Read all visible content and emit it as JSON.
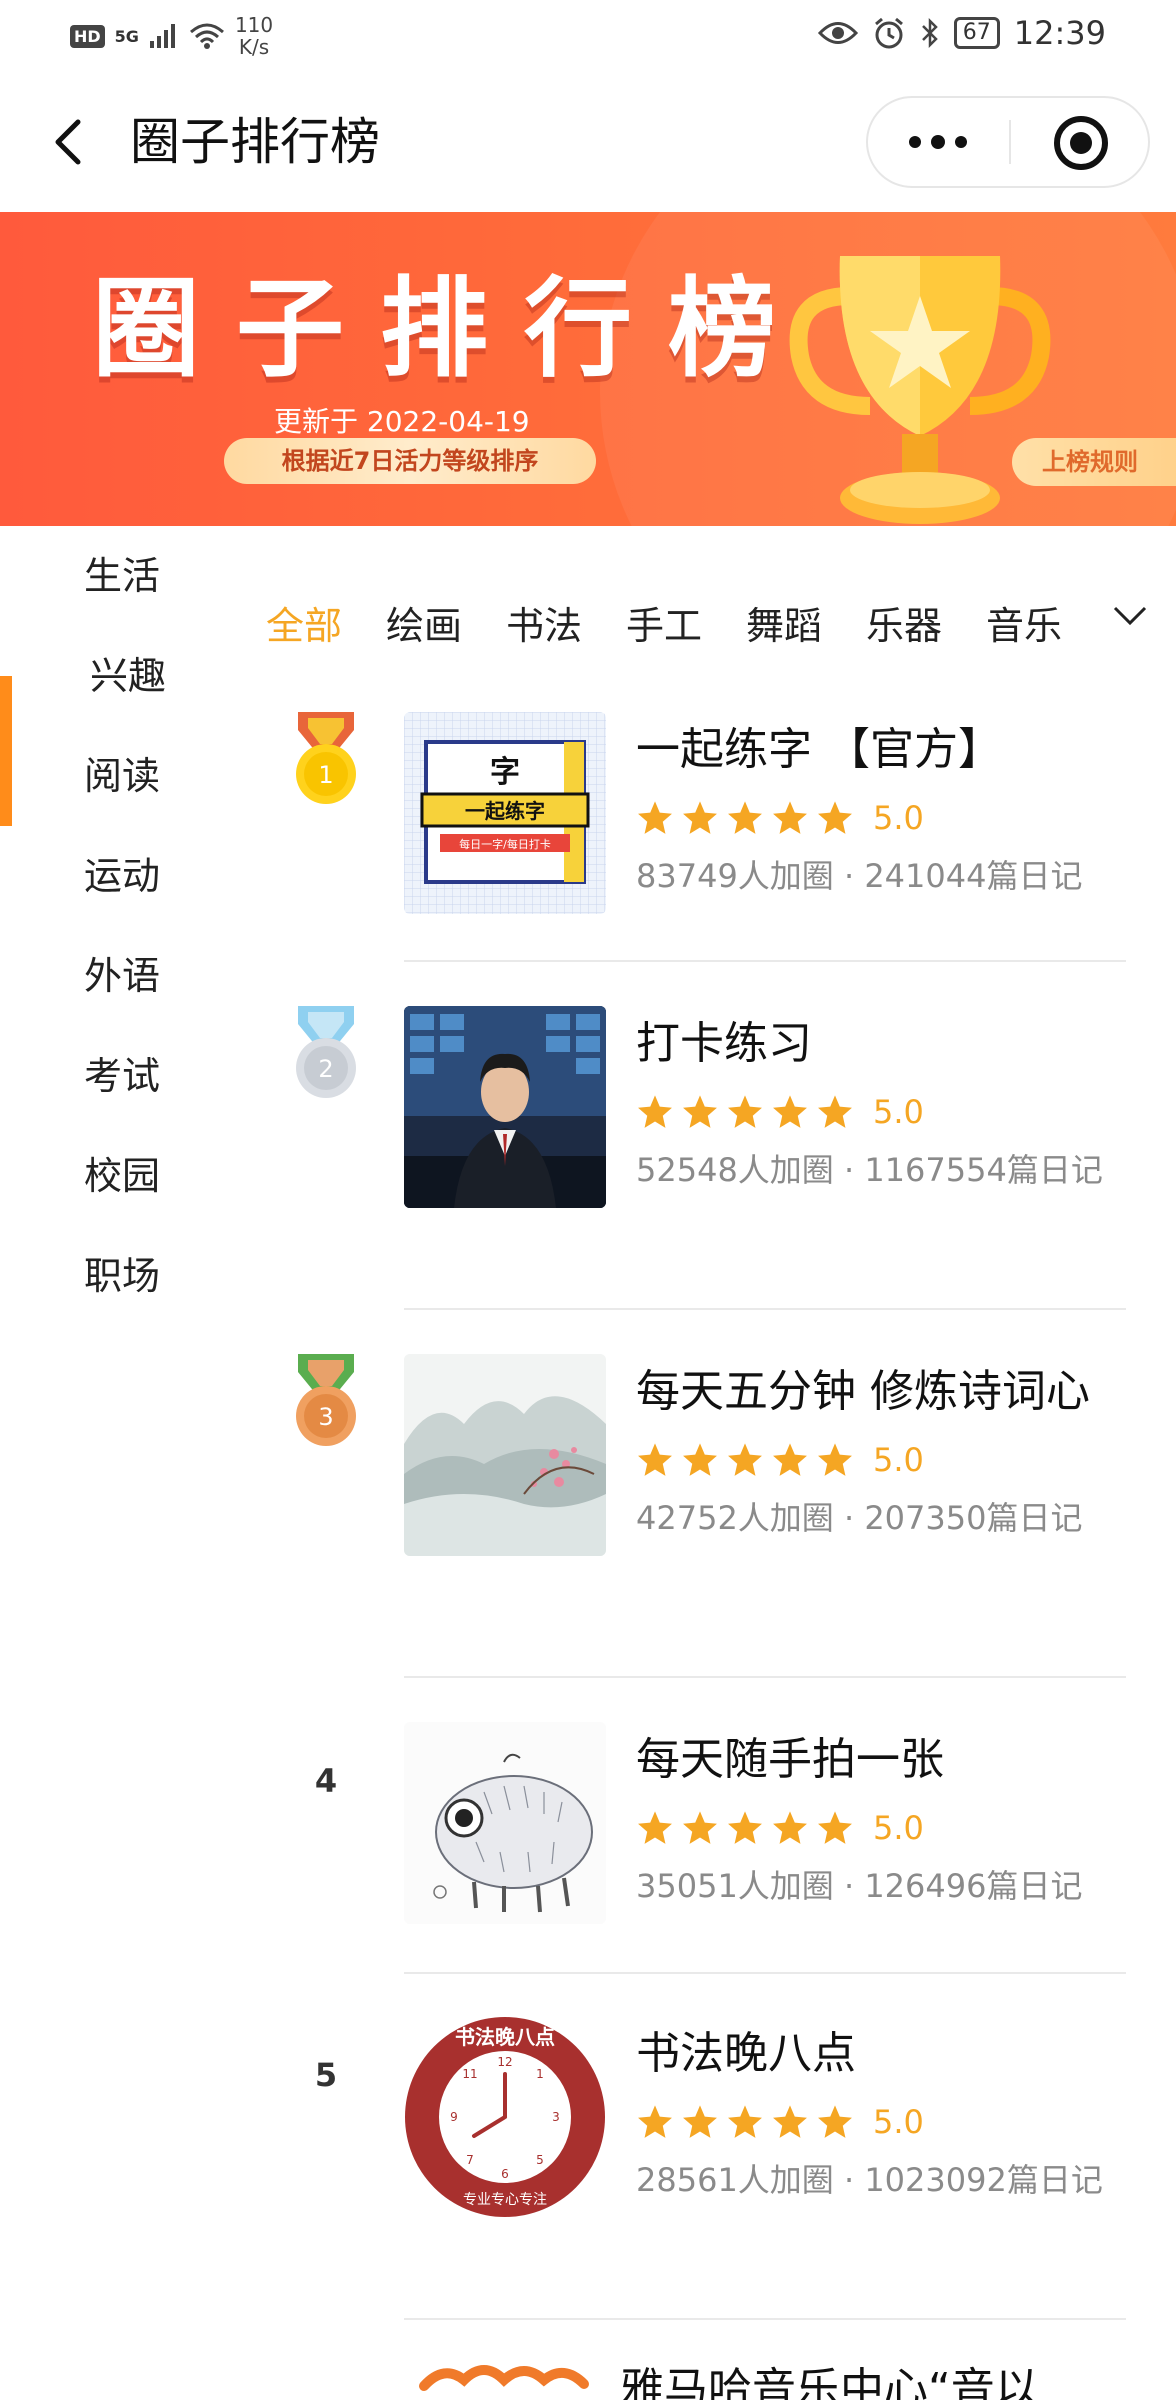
{
  "status_bar": {
    "hd": "HD",
    "network": "5G",
    "speed_value": "110",
    "speed_unit": "K/s",
    "battery": "67",
    "time": "12:39"
  },
  "nav": {
    "title": "圈子排行榜"
  },
  "banner": {
    "title": "圈子排行榜",
    "updated": "更新于 2022-04-19",
    "note": "根据近7日活力等级排序",
    "rule_button": "上榜规则"
  },
  "sidebar": {
    "items": [
      {
        "label": "生活"
      },
      {
        "label": "兴趣"
      },
      {
        "label": "阅读"
      },
      {
        "label": "运动"
      },
      {
        "label": "外语"
      },
      {
        "label": "考试"
      },
      {
        "label": "校园"
      },
      {
        "label": "职场"
      }
    ],
    "active_index": 1
  },
  "tabs": {
    "items": [
      {
        "label": "全部"
      },
      {
        "label": "绘画"
      },
      {
        "label": "书法"
      },
      {
        "label": "手工"
      },
      {
        "label": "舞蹈"
      },
      {
        "label": "乐器"
      },
      {
        "label": "音乐"
      }
    ],
    "active_index": 0
  },
  "list": [
    {
      "rank": "1",
      "medal": "gold",
      "name": "一起练字 【官方】",
      "rating": "5.0",
      "stars": 5,
      "meta": "83749人加圈 · 241044篇日记",
      "thumb": {
        "line1": "字",
        "line2": "一起练字",
        "line3": "每日一字/每日打卡"
      }
    },
    {
      "rank": "2",
      "medal": "silver",
      "name": "打卡练习",
      "rating": "5.0",
      "stars": 5,
      "meta": "52548人加圈 · 1167554篇日记"
    },
    {
      "rank": "3",
      "medal": "bronze",
      "name": "每天五分钟 修炼诗词心",
      "rating": "5.0",
      "stars": 5,
      "meta": "42752人加圈 · 207350篇日记"
    },
    {
      "rank": "4",
      "name": "每天随手拍一张",
      "rating": "5.0",
      "stars": 5,
      "meta": "35051人加圈 · 126496篇日记"
    },
    {
      "rank": "5",
      "name": "书法晚八点",
      "rating": "5.0",
      "stars": 5,
      "meta": "28561人加圈 · 1023092篇日记",
      "thumb": {
        "top": "书法晚八点",
        "bottom": "专业专心专注"
      }
    },
    {
      "name": "雅马哈音乐中心“音以"
    }
  ],
  "colors": {
    "accent": "#f5a623",
    "active_bar": "#ff8c1a",
    "banner": "#ff6a3a"
  }
}
